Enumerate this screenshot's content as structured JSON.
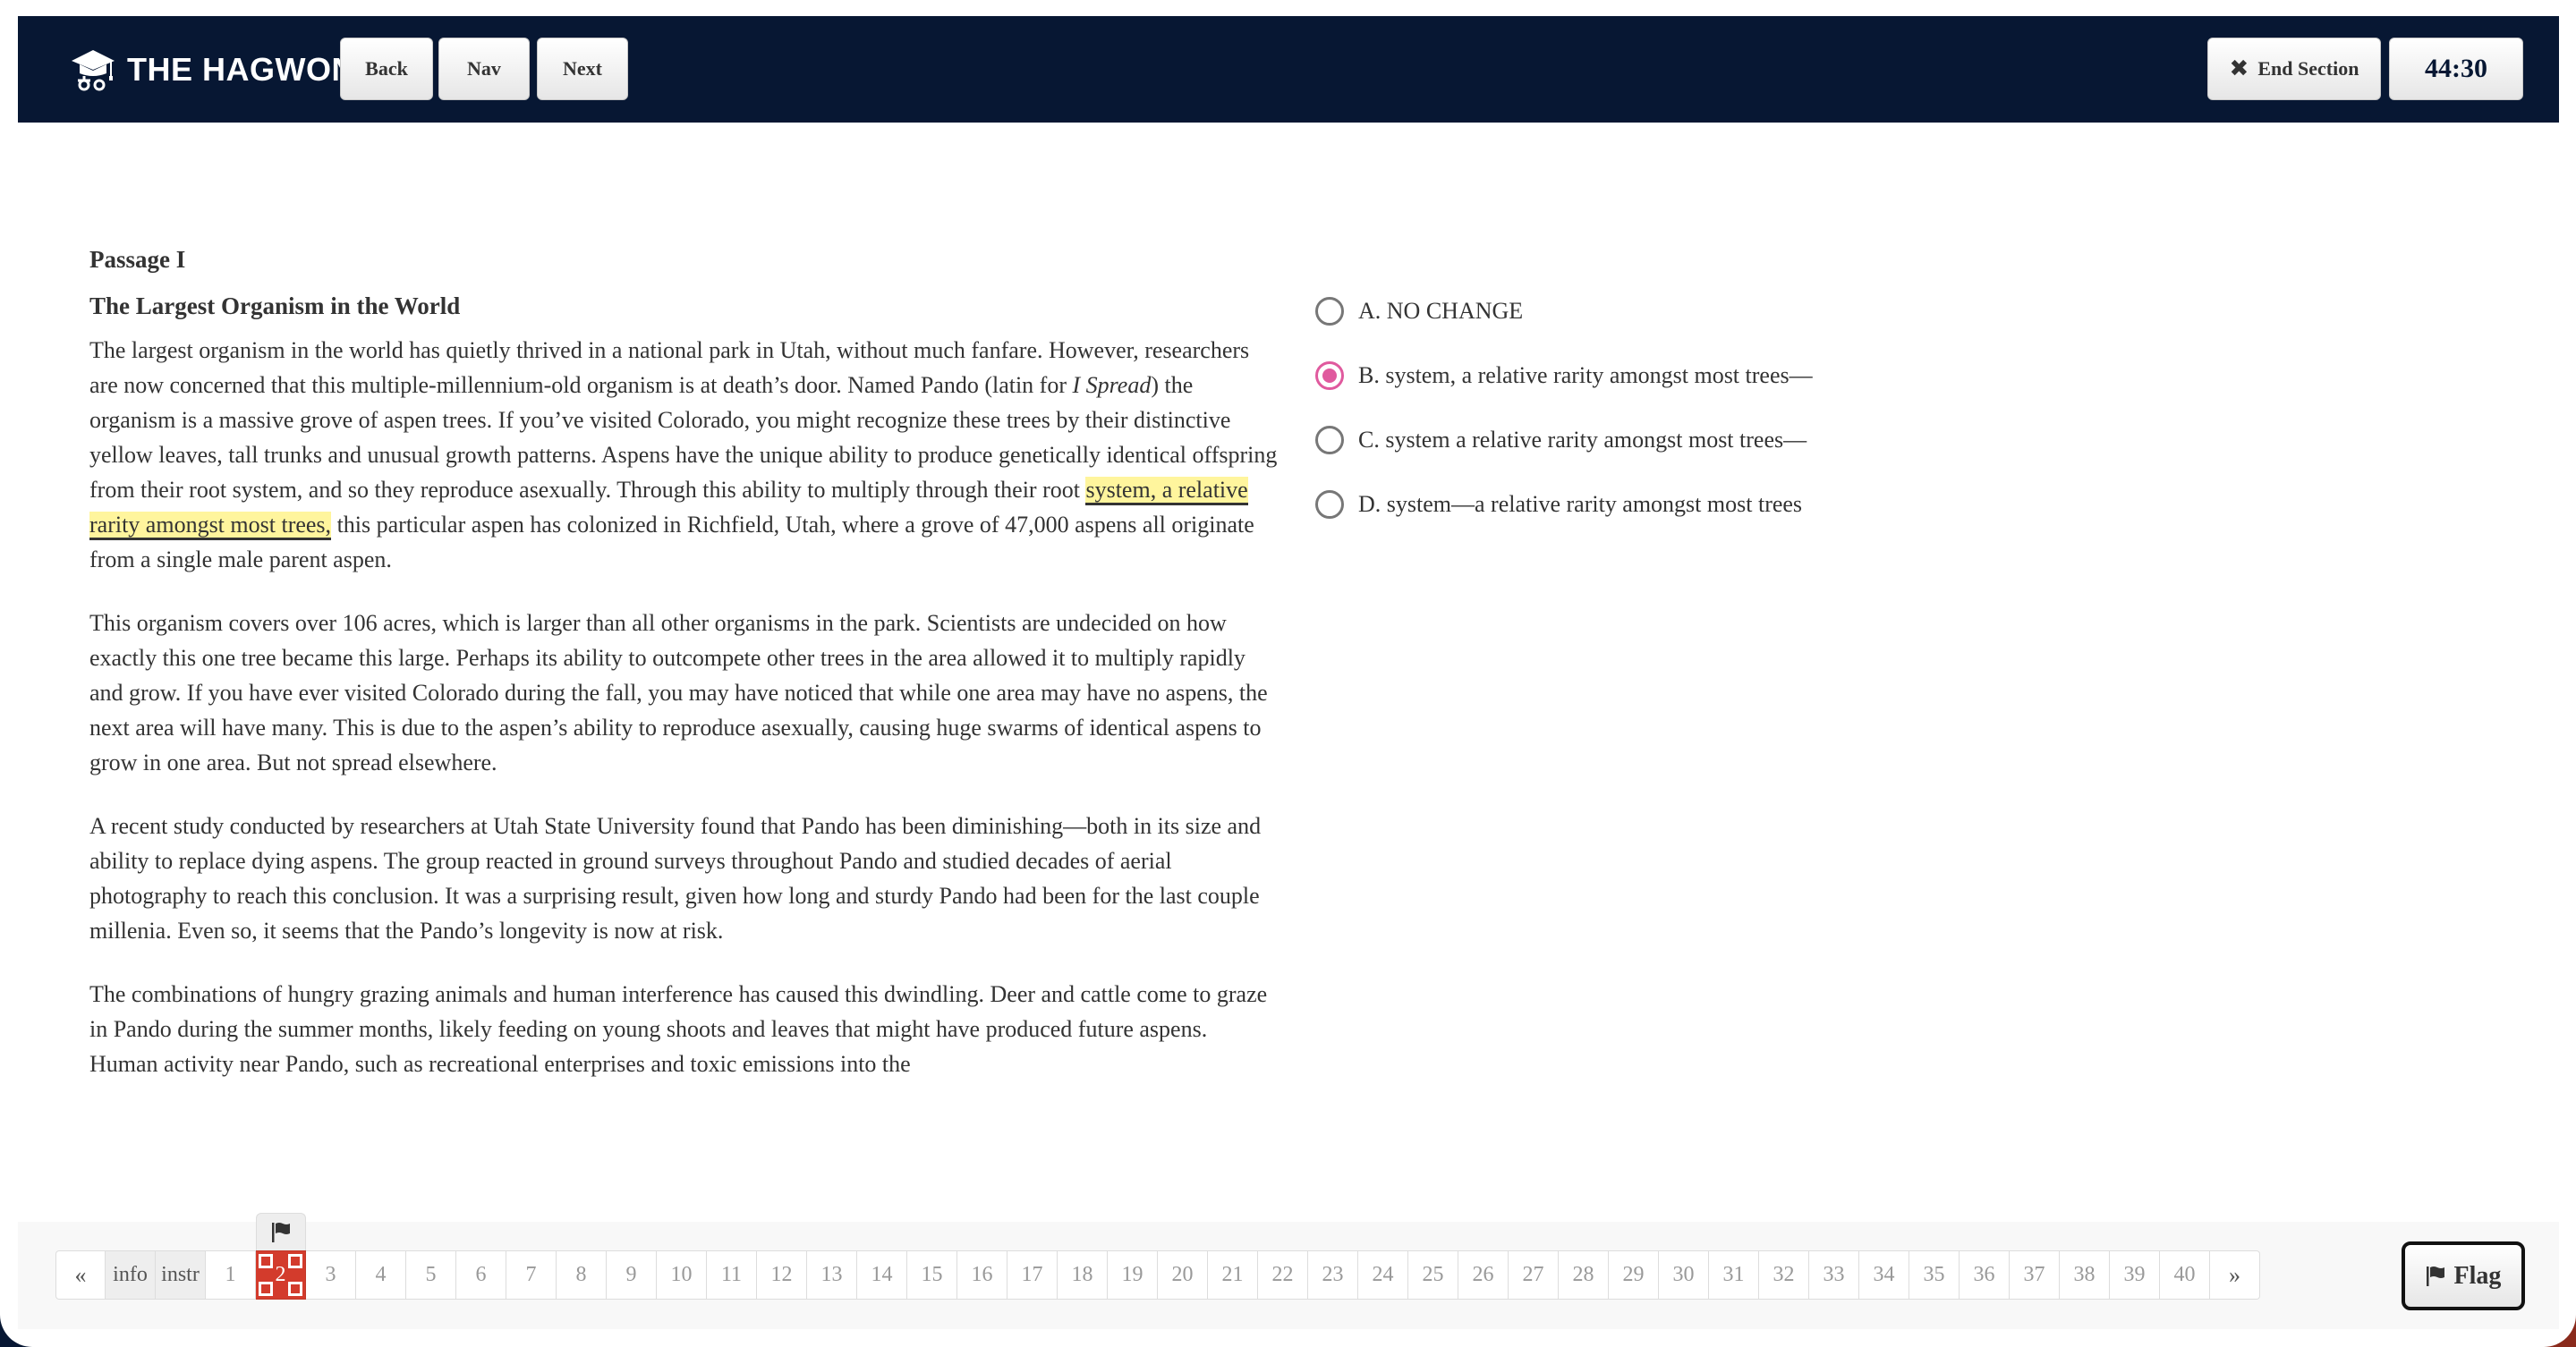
{
  "header": {
    "brand": "THE HAGWON",
    "logo_icon": "graduation-cap-icon",
    "back_label": "Back",
    "nav_label": "Nav",
    "next_label": "Next",
    "end_section_label": "End Section",
    "end_section_icon": "close-icon",
    "timer": "44:30"
  },
  "passage": {
    "label": "Passage I",
    "title": "The Largest Organism in the World",
    "p1_before_italic": "The largest organism in the world has quietly thrived in a national park in Utah, without much fanfare. However, researchers are now concerned that this multiple-millennium-old organism is at death’s door. Named Pando (latin for ",
    "p1_italic": "I Spread",
    "p1_after_italic": ") the organism is a massive grove of aspen trees. If you’ve visited Colorado, you might recognize these trees by their distinctive yellow leaves, tall trunks and unusual growth patterns. Aspens have the unique ability to produce genetically identical offspring from their root system, and so they reproduce asexually. Through this ability to multiply through their root ",
    "p1_highlight": "system, a relative rarity amongst most trees,",
    "p1_end": " this particular aspen has colonized in Richfield, Utah, where a grove of 47,000 aspens all originate from a single male parent aspen.",
    "p2": "This organism covers over 106 acres, which is larger than all other organisms in the park. Scientists are undecided on how exactly this one tree became this large. Perhaps its ability to outcompete other trees in the area allowed it to multiply rapidly and grow. If you have ever visited Colorado during the fall, you may have noticed that while one area may have no aspens, the next area will have many. This is due to the aspen’s ability to reproduce asexually, causing huge swarms of identical aspens to grow in one area. But not spread elsewhere.",
    "p3": "A recent study conducted by researchers at Utah State University found that Pando has been diminishing—both in its size and ability to replace dying aspens. The group reacted in ground surveys throughout Pando and studied decades of aerial photography to reach this conclusion. It was a surprising result, given how long and sturdy Pando had been for the last couple millenia. Even so, it seems that the Pando’s longevity is now at risk.",
    "p4": "The combinations of hungry grazing animals and human interference has caused this dwindling. Deer and cattle come to graze in Pando during the summer months, likely feeding on young shoots and leaves that might have produced future aspens. Human activity near Pando, such as recreational enterprises and toxic emissions into the"
  },
  "question": {
    "options": [
      {
        "label": "A. NO CHANGE",
        "selected": false
      },
      {
        "label": "B. system, a relative rarity amongst most trees—",
        "selected": true
      },
      {
        "label": "C. system a relative rarity amongst most trees—",
        "selected": false
      },
      {
        "label": "D. system—a relative rarity amongst most trees",
        "selected": false
      }
    ],
    "selected_color": "#e05a9e"
  },
  "pager": {
    "prev": "«",
    "info": "info",
    "instr": "instr",
    "numbers": [
      "1",
      "2",
      "3",
      "4",
      "5",
      "6",
      "7",
      "8",
      "9",
      "10",
      "11",
      "12",
      "13",
      "14",
      "15",
      "16",
      "17",
      "18",
      "19",
      "20",
      "21",
      "22",
      "23",
      "24",
      "25",
      "26",
      "27",
      "28",
      "29",
      "30",
      "31",
      "32",
      "33",
      "34",
      "35",
      "36",
      "37",
      "38",
      "39",
      "40"
    ],
    "current": "2",
    "flagged": [
      "2"
    ],
    "next": "»",
    "current_color": "#d33b2c"
  },
  "flag_button": {
    "label": "Flag",
    "icon": "flag-icon"
  },
  "colors": {
    "header_bg": "#071733",
    "highlight": "#fff59d"
  }
}
